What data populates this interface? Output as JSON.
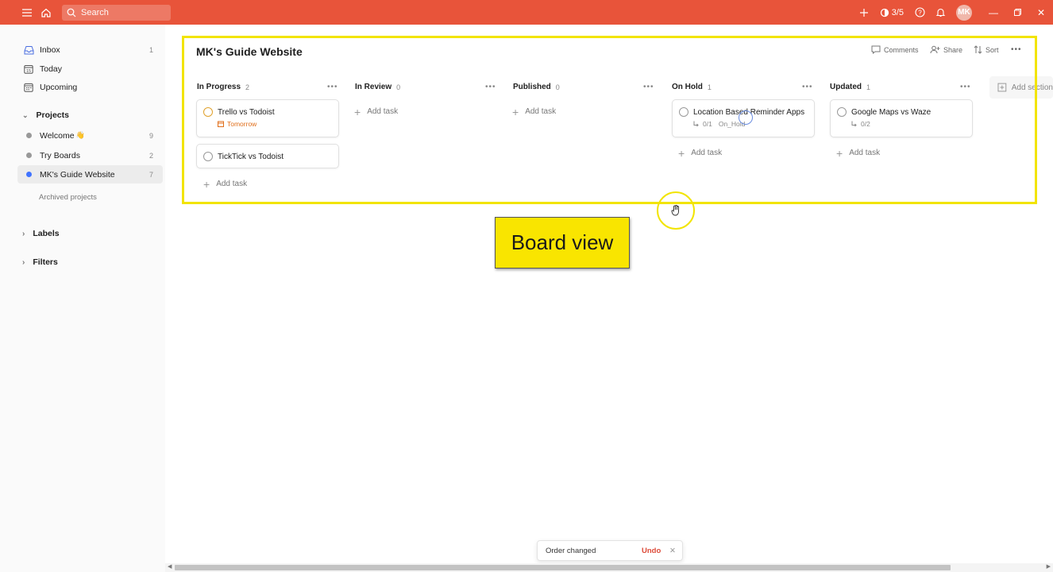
{
  "topbar": {
    "search_placeholder": "Search",
    "karma": "3/5",
    "avatar_initials": "MK"
  },
  "sidebar": {
    "items": [
      {
        "label": "Inbox",
        "count": "1"
      },
      {
        "label": "Today",
        "count": ""
      },
      {
        "label": "Upcoming",
        "count": ""
      }
    ],
    "projects_heading": "Projects",
    "projects": [
      {
        "label": "Welcome",
        "emoji": "👋",
        "count": "9",
        "color": "#999999"
      },
      {
        "label": "Try Boards",
        "count": "2",
        "color": "#999999"
      },
      {
        "label": "MK's Guide Website",
        "count": "7",
        "color": "#4073ff"
      }
    ],
    "archived": "Archived projects",
    "labels_heading": "Labels",
    "filters_heading": "Filters"
  },
  "main": {
    "title": "MK's Guide Website",
    "actions": {
      "comments": "Comments",
      "share": "Share",
      "sort": "Sort"
    },
    "add_task": "Add task",
    "add_section": "Add section",
    "columns": [
      {
        "name": "In Progress",
        "count": "2"
      },
      {
        "name": "In Review",
        "count": "0"
      },
      {
        "name": "Published",
        "count": "0"
      },
      {
        "name": "On Hold",
        "count": "1"
      },
      {
        "name": "Updated",
        "count": "1"
      }
    ],
    "cards": {
      "trello": {
        "name": "Trello vs Todoist",
        "due": "Tomorrow"
      },
      "ticktick": {
        "name": "TickTick vs Todoist"
      },
      "location": {
        "name": "Location Based Reminder Apps",
        "subtasks": "0/1",
        "label": "On_Hold"
      },
      "google": {
        "name": "Google Maps vs Waze",
        "subtasks": "0/2"
      }
    }
  },
  "overlay": {
    "board_view": "Board view"
  },
  "toast": {
    "message": "Order changed",
    "undo": "Undo"
  },
  "colors": {
    "accent": "#e8543a",
    "highlight": "#f2e400",
    "undo": "#dd4b39"
  }
}
